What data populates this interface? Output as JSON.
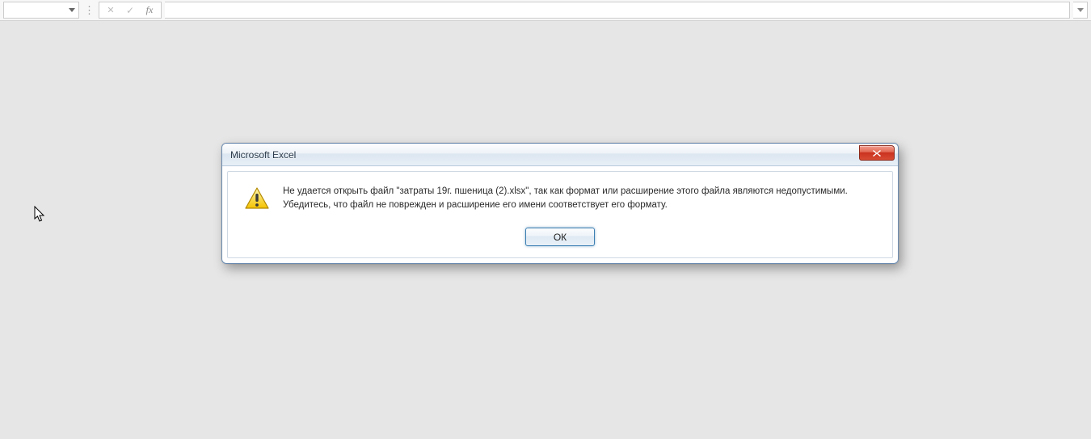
{
  "formula_bar": {
    "name_box_value": "",
    "fx_label": "fx",
    "formula_value": ""
  },
  "dialog": {
    "title": "Microsoft Excel",
    "message": "Не удается открыть файл \"затраты 19г. пшеница (2).xlsx\", так как формат или расширение этого файла являются недопустимыми. Убедитесь, что файл не поврежден и расширение его имени соответствует его формату.",
    "ok_label": "ОК"
  }
}
